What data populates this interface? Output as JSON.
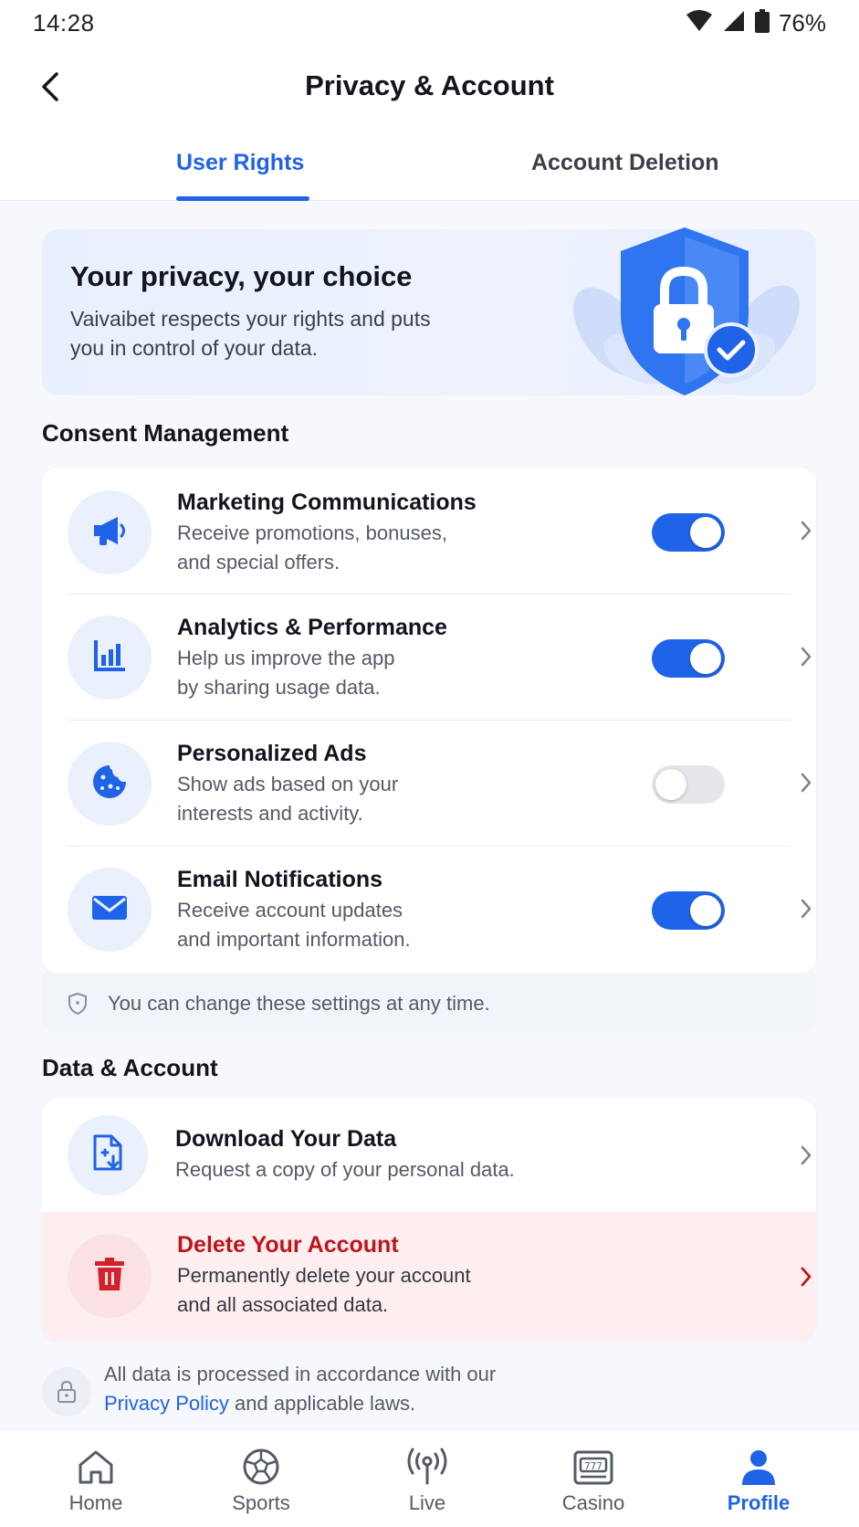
{
  "status_bar": {
    "time": "14:28",
    "battery": "76%"
  },
  "app_bar": {
    "title": "Privacy & Account"
  },
  "tabs": [
    {
      "label": "User Rights",
      "active": true
    },
    {
      "label": "Account Deletion",
      "active": false
    }
  ],
  "hero": {
    "title": "Your privacy, your choice",
    "subtitle": "Vaivaibet respects your rights and puts you in control of your data.",
    "icon": "shield-lock-icon"
  },
  "consent": {
    "section_title": "Consent Management",
    "items": [
      {
        "title": "Marketing Communications",
        "subtitle_line1": "Receive promotions, bonuses,",
        "subtitle_line2": "and special offers.",
        "enabled": true,
        "icon": "megaphone-icon"
      },
      {
        "title": "Analytics & Performance",
        "subtitle_line1": "Help us improve the app",
        "subtitle_line2": "by sharing usage data.",
        "enabled": true,
        "icon": "bar-chart-icon"
      },
      {
        "title": "Personalized Ads",
        "subtitle_line1": "Show ads based on your",
        "subtitle_line2": "interests and activity.",
        "enabled": false,
        "icon": "cookie-icon"
      },
      {
        "title": "Email Notifications",
        "subtitle_line1": "Receive account updates",
        "subtitle_line2": "and important information.",
        "enabled": true,
        "icon": "envelope-icon"
      }
    ],
    "note": "You can change these settings at any time."
  },
  "data_account": {
    "section_title": "Data & Account",
    "download": {
      "title": "Download Your Data",
      "subtitle": "Request a copy of your personal data.",
      "icon": "file-download-icon"
    },
    "delete": {
      "title": "Delete Your Account",
      "subtitle_line1": "Permanently delete your account",
      "subtitle_line2": "and all associated data.",
      "icon": "trash-icon"
    }
  },
  "footer": {
    "line1": "All data is processed in accordance with our",
    "link": "Privacy Policy",
    "line2_rest": " and applicable laws."
  },
  "bottom_nav": [
    {
      "label": "Home",
      "icon": "home-icon",
      "active": false
    },
    {
      "label": "Sports",
      "icon": "soccer-ball-icon",
      "active": false
    },
    {
      "label": "Live",
      "icon": "broadcast-icon",
      "active": false
    },
    {
      "label": "Casino",
      "icon": "slot-machine-icon",
      "active": false
    },
    {
      "label": "Profile",
      "icon": "person-icon",
      "active": true
    }
  ],
  "colors": {
    "accent": "#1f63e8",
    "danger": "#c0141c",
    "toggle_off": "#e4e6ec"
  }
}
